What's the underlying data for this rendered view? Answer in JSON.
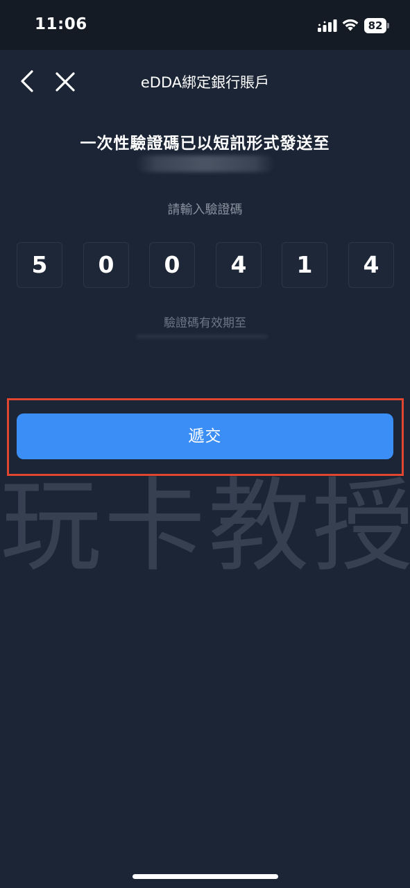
{
  "status_bar": {
    "time": "11:06",
    "battery_level": "82",
    "signal_bars": 4,
    "wifi_on": true
  },
  "nav": {
    "title": "eDDA綁定銀行賬戶",
    "back_icon": "chevron-left-icon",
    "close_icon": "close-icon"
  },
  "verification": {
    "headline": "一次性驗證碼已以短訊形式發送至",
    "prompt": "請輸入驗證碼",
    "code_digits": [
      "5",
      "0",
      "0",
      "4",
      "1",
      "4"
    ],
    "expiry_label": "驗證碼有效期至"
  },
  "actions": {
    "submit_label": "遞交"
  },
  "watermark": {
    "text": "玩卡教授"
  },
  "colors": {
    "background": "#1b2535",
    "status_bar": "#151b24",
    "primary_button": "#3a8ef6",
    "highlight_frame": "#e0452f"
  }
}
